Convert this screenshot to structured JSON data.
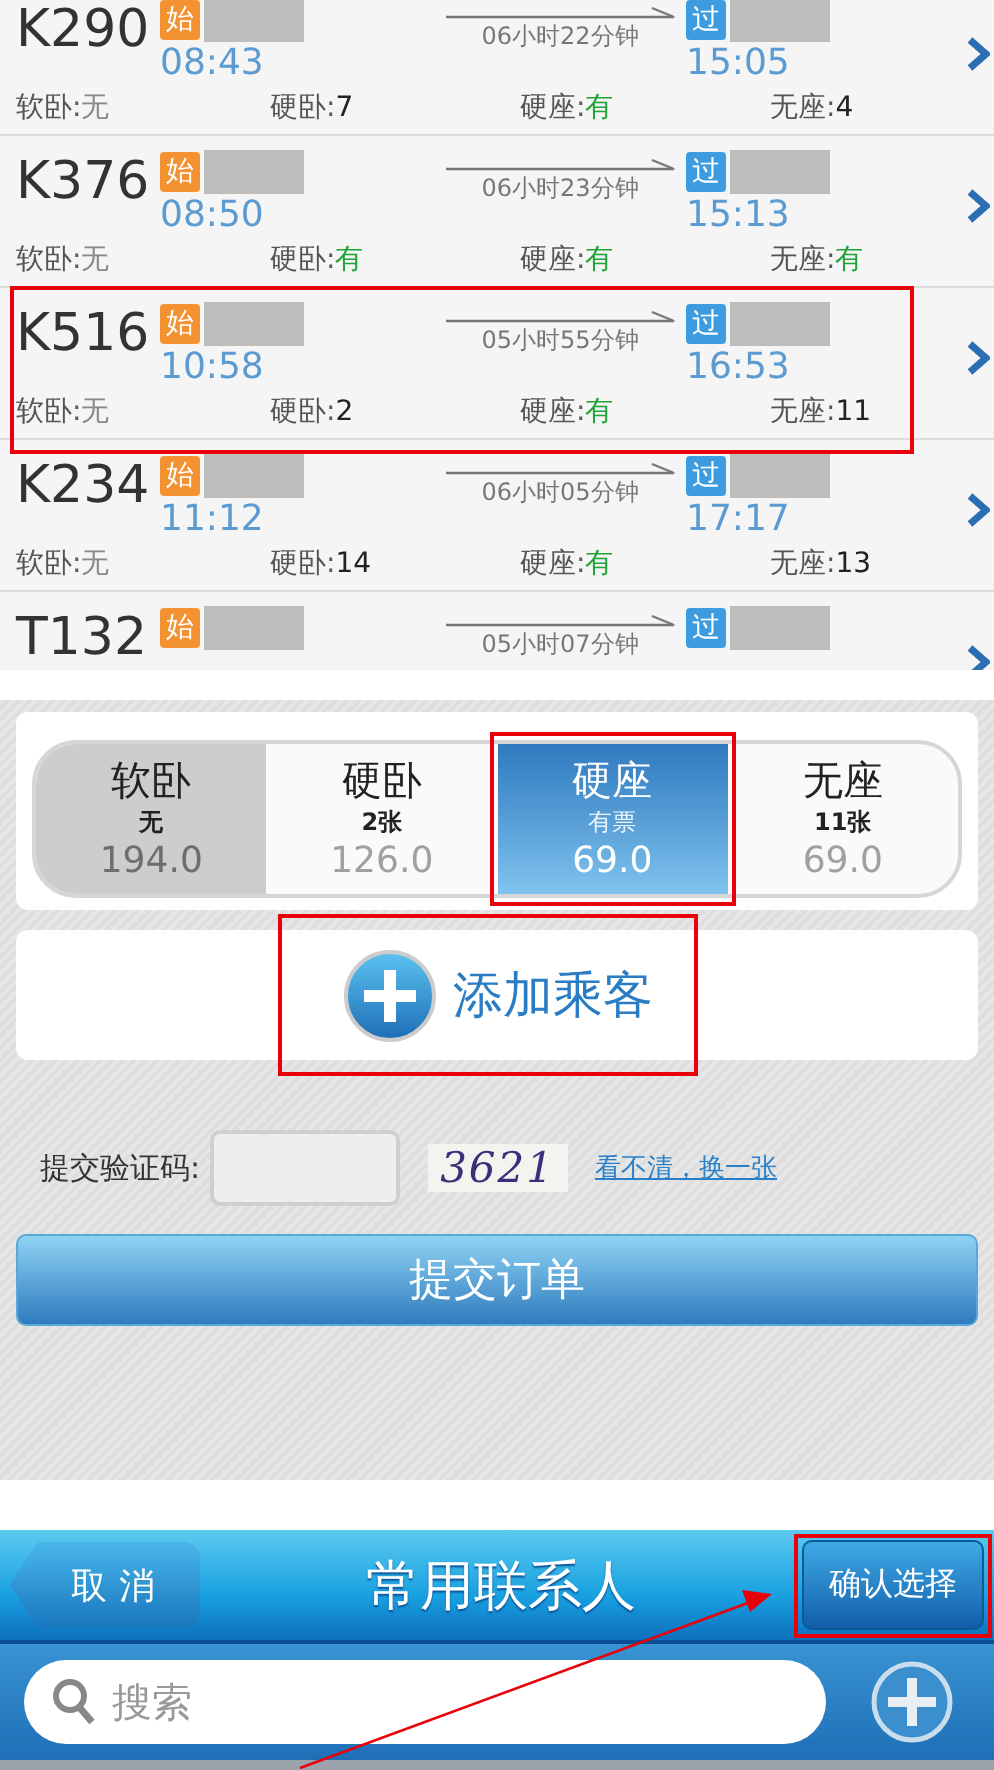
{
  "trains": [
    {
      "number": "K290",
      "origin_badge": "始",
      "departs": "08:43",
      "duration": "06小时22分钟",
      "stop_badge": "过",
      "arrives": "15:05",
      "highlighted": false,
      "seats": [
        {
          "label": "软卧:",
          "value": "无",
          "kind": "none"
        },
        {
          "label": "硬卧:",
          "value": "7",
          "kind": "count"
        },
        {
          "label": "硬座:",
          "value": "有",
          "kind": "available"
        },
        {
          "label": "无座:",
          "value": "4",
          "kind": "count"
        }
      ]
    },
    {
      "number": "K376",
      "origin_badge": "始",
      "departs": "08:50",
      "duration": "06小时23分钟",
      "stop_badge": "过",
      "arrives": "15:13",
      "highlighted": false,
      "seats": [
        {
          "label": "软卧:",
          "value": "无",
          "kind": "none"
        },
        {
          "label": "硬卧:",
          "value": "有",
          "kind": "available"
        },
        {
          "label": "硬座:",
          "value": "有",
          "kind": "available"
        },
        {
          "label": "无座:",
          "value": "有",
          "kind": "available"
        }
      ]
    },
    {
      "number": "K516",
      "origin_badge": "始",
      "departs": "10:58",
      "duration": "05小时55分钟",
      "stop_badge": "过",
      "arrives": "16:53",
      "highlighted": true,
      "seats": [
        {
          "label": "软卧:",
          "value": "无",
          "kind": "none"
        },
        {
          "label": "硬卧:",
          "value": "2",
          "kind": "count"
        },
        {
          "label": "硬座:",
          "value": "有",
          "kind": "available"
        },
        {
          "label": "无座:",
          "value": "11",
          "kind": "count"
        }
      ]
    },
    {
      "number": "K234",
      "origin_badge": "始",
      "departs": "11:12",
      "duration": "06小时05分钟",
      "stop_badge": "过",
      "arrives": "17:17",
      "highlighted": false,
      "seats": [
        {
          "label": "软卧:",
          "value": "无",
          "kind": "none"
        },
        {
          "label": "硬卧:",
          "value": "14",
          "kind": "count"
        },
        {
          "label": "硬座:",
          "value": "有",
          "kind": "available"
        },
        {
          "label": "无座:",
          "value": "13",
          "kind": "count"
        }
      ]
    },
    {
      "number": "T132",
      "origin_badge": "始",
      "duration": "05小时07分钟",
      "stop_badge": "过",
      "highlighted": false
    }
  ],
  "seat_classes": [
    {
      "name": "软卧",
      "availability": "无",
      "price": "194.0",
      "selected": false,
      "disabled": true,
      "highlighted": false
    },
    {
      "name": "硬卧",
      "availability": "2张",
      "price": "126.0",
      "selected": false,
      "disabled": false,
      "highlighted": false
    },
    {
      "name": "硬座",
      "availability": "有票",
      "price": "69.0",
      "selected": true,
      "disabled": false,
      "highlighted": true
    },
    {
      "name": "无座",
      "availability": "11张",
      "price": "69.0",
      "selected": false,
      "disabled": false,
      "highlighted": false
    }
  ],
  "add_passenger": {
    "label": "添加乘客",
    "highlighted": true
  },
  "captcha": {
    "label": "提交验证码:",
    "code": "3621",
    "refresh_link": "看不清，换一张"
  },
  "submit_button": "提交订单",
  "contacts_header": {
    "cancel": "取 消",
    "title": "常用联系人",
    "confirm": "确认选择",
    "confirm_highlighted": true
  },
  "search": {
    "placeholder": "搜索"
  },
  "annotation_arrow": true
}
